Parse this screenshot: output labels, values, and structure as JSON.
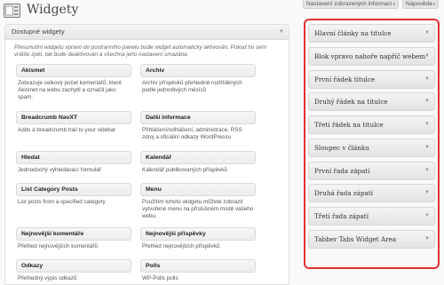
{
  "header": {
    "title": "Widgety",
    "screen_options": "Nastavení zobrazených informací",
    "help": "Nápověda"
  },
  "available": {
    "title": "Dostupné widgety",
    "description": "Přesunutím widgetu vpravo do postranního panelu bude widget automaticky aktivován. Pokud ho sem vrátíte zpět, tak bude deaktivován a všechna jeho nastavení smazána.",
    "widgets": [
      {
        "name": "Akismet",
        "desc": "Zobrazuje celkový počet komentářů, které Akismet na webu zachytil a označil jako spam."
      },
      {
        "name": "Archiv",
        "desc": "Archiv příspěvků přehledně roztříděných podle jednotlivých měsíců"
      },
      {
        "name": "Breadcrumb NavXT",
        "desc": "Adds a breadcrumb trail to your sidebar"
      },
      {
        "name": "Další informace",
        "desc": "Přihlášení/odhlášení, administrace, RSS zdroj a oficiální odkazy WordPressu"
      },
      {
        "name": "Hledat",
        "desc": "Jednoduchý vyhledávací formulář"
      },
      {
        "name": "Kalendář",
        "desc": "Kalendář publikovaných příspěvků"
      },
      {
        "name": "List Category Posts",
        "desc": "List posts from a specified category"
      },
      {
        "name": "Menu",
        "desc": "Použitím tohoto widgetu můžete zobrazit vytvořené menu na příslušném místě vašeho webu."
      },
      {
        "name": "Nejnovější komentáře",
        "desc": "Přehled nejnovějších komentářů"
      },
      {
        "name": "Nejnovější příspěvky",
        "desc": "Přehled nejnovějších příspěvků"
      },
      {
        "name": "Odkazy",
        "desc": "Přehledný výpis odkazů"
      },
      {
        "name": "Polls",
        "desc": "WP-Polls polls"
      }
    ]
  },
  "sidebars": [
    "Hlavní články na titulce",
    "Blok vpravo nahoře napříč webem",
    "První řádek titulce",
    "Druhý řádek na titulce",
    "Třetí řádek na titulce",
    "Sloupec v článku",
    "První řada zápatí",
    "Druhá řada zápatí",
    "Třetí řada zápatí",
    "Tabber Tabs Widget Area"
  ]
}
